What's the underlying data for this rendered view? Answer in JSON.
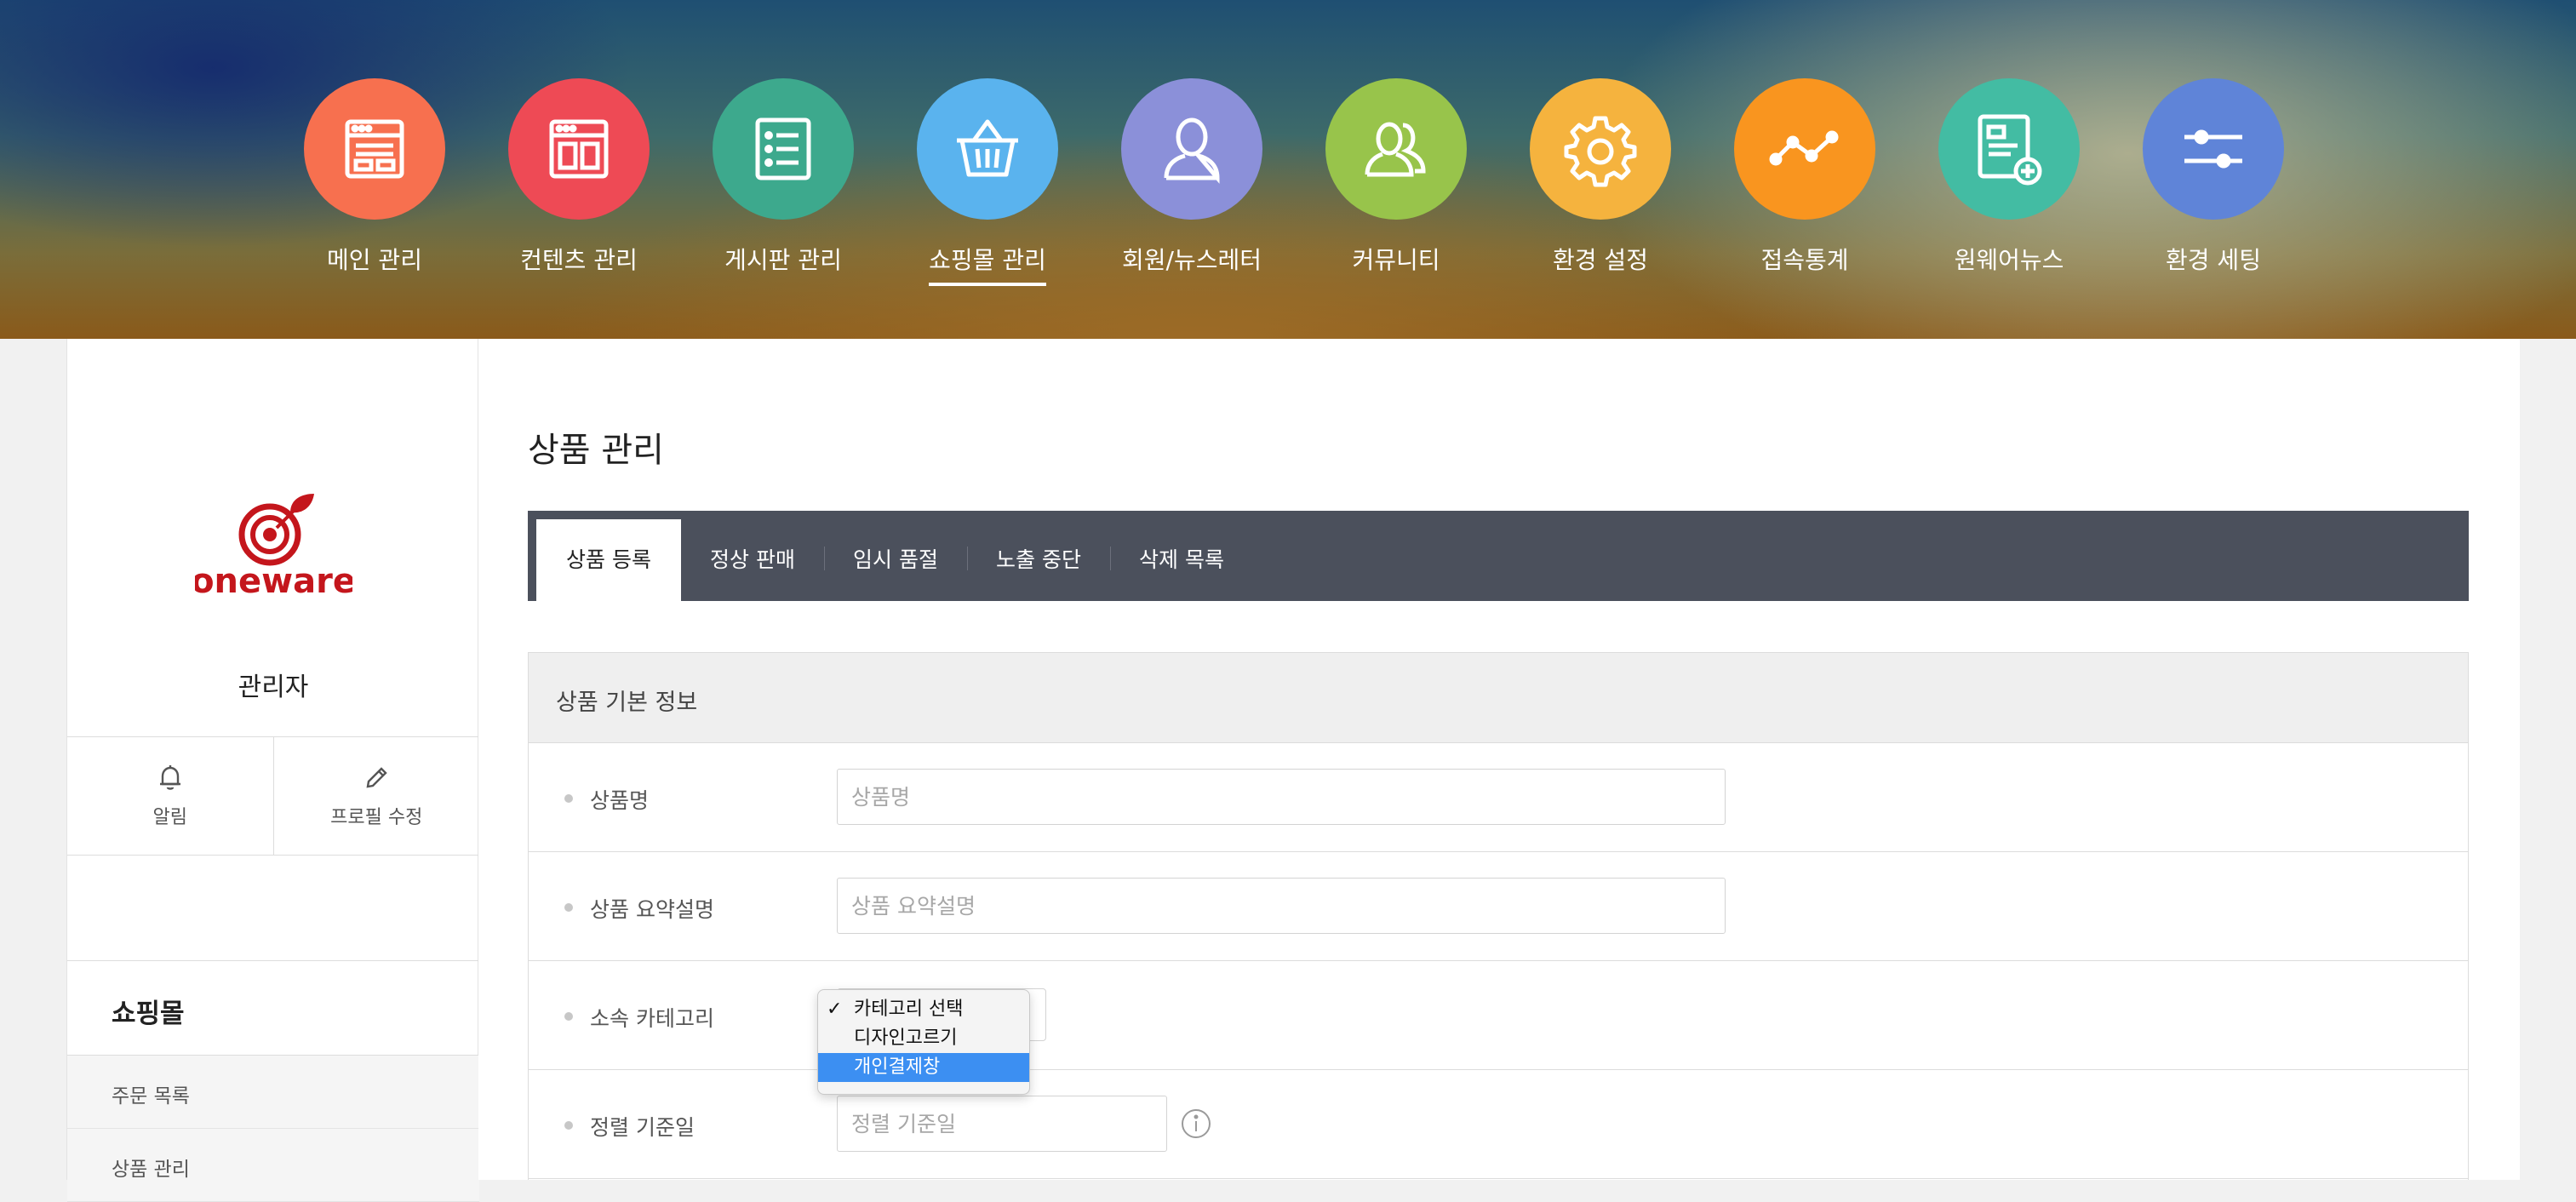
{
  "nav": [
    {
      "label": "메인 관리",
      "icon": "layout-icon",
      "color": "#f7704f"
    },
    {
      "label": "컨텐츠 관리",
      "icon": "content-icon",
      "color": "#ee4a55"
    },
    {
      "label": "게시판 관리",
      "icon": "list-icon",
      "color": "#3da98d"
    },
    {
      "label": "쇼핑몰 관리",
      "icon": "basket-icon",
      "color": "#5ab3ee",
      "active": true
    },
    {
      "label": "회원/뉴스레터",
      "icon": "user-icon",
      "color": "#8b90d9"
    },
    {
      "label": "커뮤니티",
      "icon": "users-icon",
      "color": "#98c44b"
    },
    {
      "label": "환경 설정",
      "icon": "gear-icon",
      "color": "#f5b33e"
    },
    {
      "label": "접속통계",
      "icon": "stats-icon",
      "color": "#f9951f"
    },
    {
      "label": "원웨어뉴스",
      "icon": "news-add-icon",
      "color": "#43bca3"
    },
    {
      "label": "환경 세팅",
      "icon": "sliders-icon",
      "color": "#5f84d8"
    }
  ],
  "sidebar": {
    "logo_text": "oneware",
    "admin_name": "관리자",
    "alert_label": "알림",
    "profile_label": "프로필 수정",
    "section_title": "쇼핑몰",
    "links": [
      "주문 목록",
      "상품 관리"
    ]
  },
  "main": {
    "title": "상품 관리",
    "tabs": [
      "상품 등록",
      "정상 판매",
      "임시 품절",
      "노출 중단",
      "삭제 목록"
    ],
    "form_title": "상품 기본 정보",
    "fields": {
      "name_label": "상품명",
      "name_placeholder": "상품명",
      "summary_label": "상품 요약설명",
      "summary_placeholder": "상품 요약설명",
      "category_label": "소속 카테고리",
      "sort_label": "정렬 기준일",
      "sort_placeholder": "정렬 기준일"
    },
    "category_options": [
      "카테고리 선택",
      "디자인고르기",
      "개인결제창"
    ],
    "category_checked": "카테고리 선택",
    "category_highlighted": "개인결제창"
  },
  "colors": {
    "tabbar": "#4b505c",
    "highlight": "#3c8ff2",
    "logo_red": "#c4161c"
  }
}
